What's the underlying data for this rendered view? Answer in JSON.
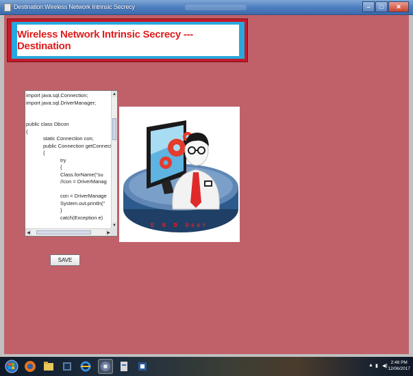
{
  "window": {
    "title": "Destination:Wireless Network Intrinsic Secrecy",
    "controls": {
      "minimize": "–",
      "maximize": "□",
      "close": "✕"
    }
  },
  "header": {
    "title": "Wireless Network Intrinsic Secrecy --- Destination"
  },
  "code_area": {
    "lines": "import java.sql.Connection;\nimport java.sql.DriverManager;\n\n\npublic class Dbcon\n{\n            static Connection con;\n            public Connection getConnection()\n            {\n                        try\n                        {\n                        Class.forName(\"su\n                        //con = DriverManag\n\n                        con = DriverManage\n                        System.out.println(\"\n                        }\n                        catch(Exception e)"
  },
  "end_user_image": {
    "label": "E N D  User"
  },
  "actions": {
    "save_label": "SAVE"
  },
  "taskbar": {
    "items": [
      "start",
      "firefox",
      "file-explorer",
      "terminal",
      "internet-explorer",
      "java",
      "app",
      "word"
    ],
    "time": "2:48 PM",
    "date": "12/06/2017"
  },
  "colors": {
    "content_background": "#c0616a",
    "banner_red": "#c41a2a",
    "banner_cyan": "#29a7dd",
    "title_red": "#e01c1c"
  }
}
